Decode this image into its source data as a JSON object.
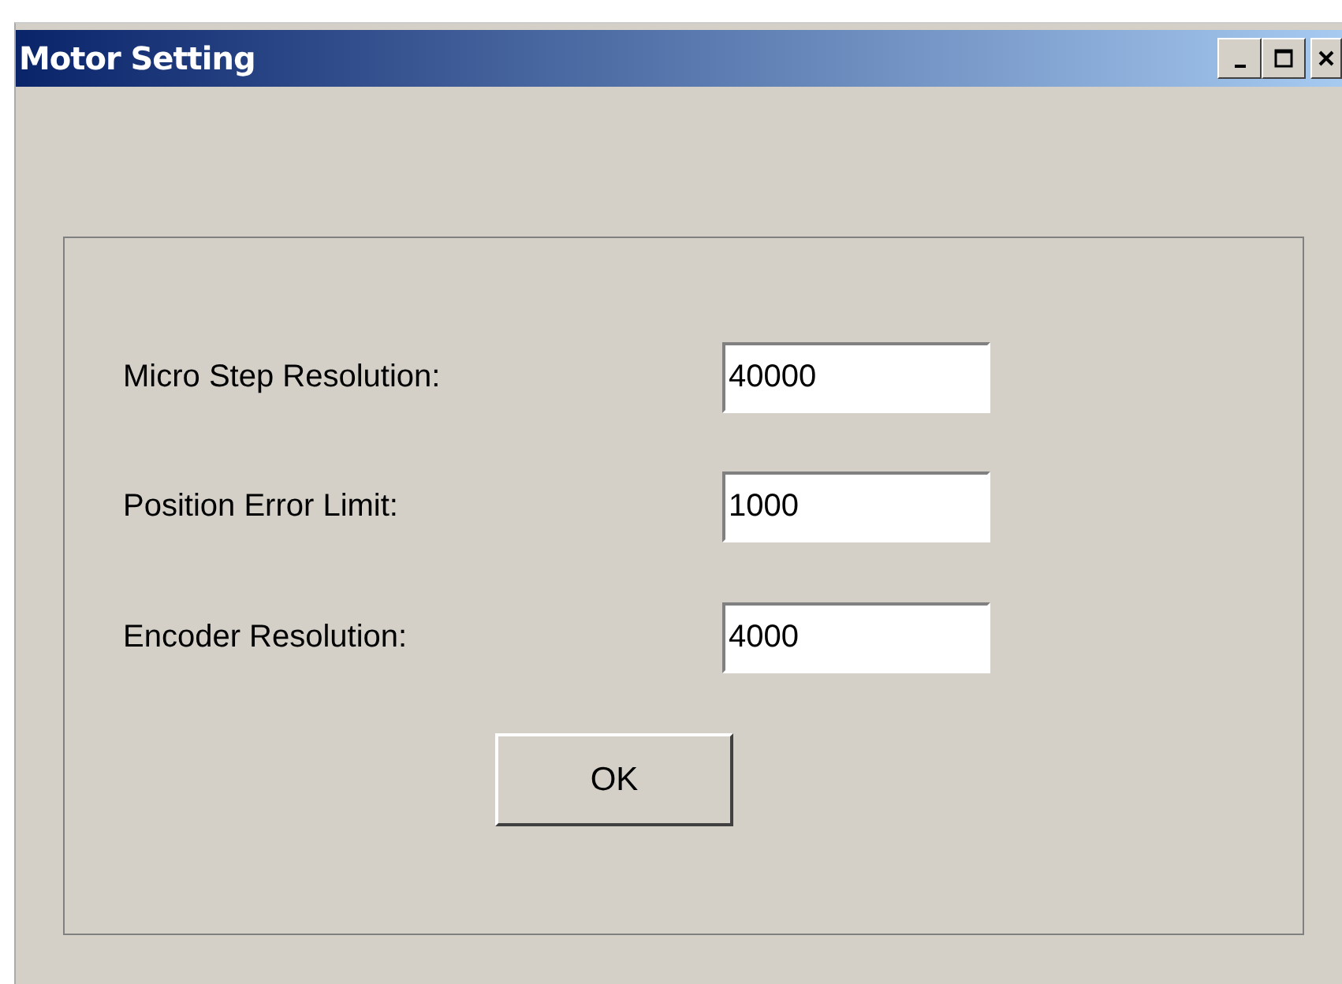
{
  "window": {
    "title": "Motor Setting"
  },
  "fields": [
    {
      "label": "Micro Step Resolution:",
      "value": "40000"
    },
    {
      "label": "Position Error Limit:",
      "value": "1000"
    },
    {
      "label": "Encoder Resolution:",
      "value": "4000"
    }
  ],
  "buttons": [
    "OK"
  ]
}
